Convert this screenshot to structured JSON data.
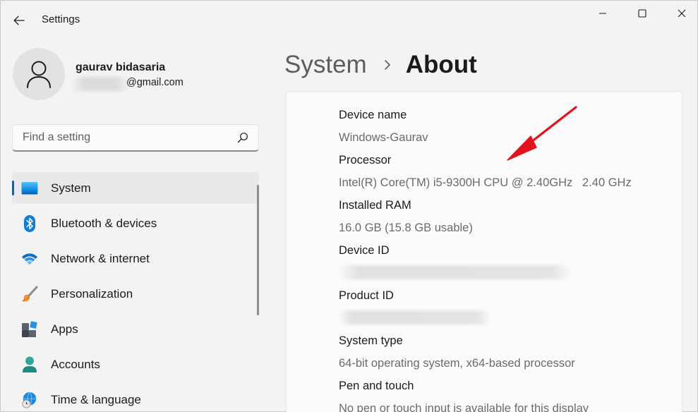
{
  "window": {
    "title": "Settings",
    "controls": {
      "minimize_icon": "minimize-icon",
      "maximize_icon": "maximize-icon",
      "close_icon": "close-icon"
    }
  },
  "user": {
    "name": "gaurav bidasaria",
    "email_visible": "@gmail.com"
  },
  "search": {
    "placeholder": "Find a setting",
    "icon": "search-icon"
  },
  "sidebar": {
    "items": [
      {
        "label": "System",
        "icon": "system-monitor-icon",
        "active": true
      },
      {
        "label": "Bluetooth & devices",
        "icon": "bluetooth-icon",
        "active": false
      },
      {
        "label": "Network & internet",
        "icon": "wifi-icon",
        "active": false
      },
      {
        "label": "Personalization",
        "icon": "paintbrush-icon",
        "active": false
      },
      {
        "label": "Apps",
        "icon": "apps-icon",
        "active": false
      },
      {
        "label": "Accounts",
        "icon": "accounts-icon",
        "active": false
      },
      {
        "label": "Time & language",
        "icon": "globe-clock-icon",
        "active": false
      }
    ]
  },
  "breadcrumb": {
    "parent": "System",
    "current": "About"
  },
  "specs": {
    "device_name": {
      "label": "Device name",
      "value": "Windows-Gaurav"
    },
    "processor": {
      "label": "Processor",
      "value": "Intel(R) Core(TM) i5-9300H CPU @ 2.40GHz   2.40 GHz"
    },
    "ram": {
      "label": "Installed RAM",
      "value": "16.0 GB (15.8 GB usable)"
    },
    "device_id": {
      "label": "Device ID"
    },
    "product_id": {
      "label": "Product ID"
    },
    "system_type": {
      "label": "System type",
      "value": "64-bit operating system, x64-based processor"
    },
    "pen_touch": {
      "label": "Pen and touch",
      "value": "No pen or touch input is available for this display"
    }
  },
  "colors": {
    "accent": "#0067c0",
    "background": "#f3f3f3",
    "card": "#fbfbfb",
    "annotation_arrow": "#e0141e"
  }
}
